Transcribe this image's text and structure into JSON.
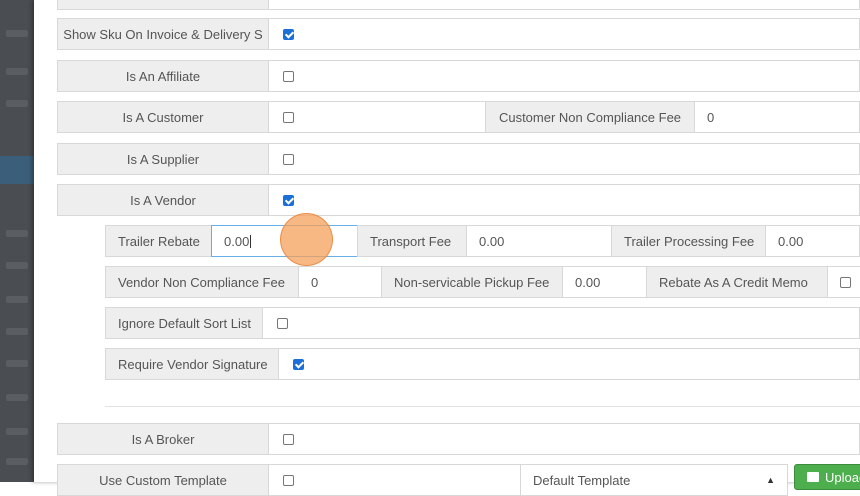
{
  "form": {
    "show_sku": {
      "label": "Show Sku On Invoice & Delivery S",
      "checked": true
    },
    "is_affiliate": {
      "label": "Is An Affiliate",
      "checked": false
    },
    "is_customer": {
      "label": "Is A Customer",
      "checked": false
    },
    "customer_fee": {
      "label": "Customer Non Compliance Fee",
      "value": "0"
    },
    "is_supplier": {
      "label": "Is A Supplier",
      "checked": false
    },
    "is_vendor": {
      "label": "Is A Vendor",
      "checked": true
    },
    "vendor": {
      "trailer_rebate": {
        "label": "Trailer Rebate",
        "value": "0.00"
      },
      "transport_fee": {
        "label": "Transport Fee",
        "value": "0.00"
      },
      "trailer_processing_fee": {
        "label": "Trailer Processing Fee",
        "value": "0.00"
      },
      "vendor_fee": {
        "label": "Vendor Non Compliance Fee",
        "value": "0"
      },
      "pickup_fee": {
        "label": "Non-servicable Pickup Fee",
        "value": "0.00"
      },
      "rebate_credit_memo": {
        "label": "Rebate As A Credit Memo",
        "checked": false
      },
      "ignore_sort": {
        "label": "Ignore Default Sort List",
        "checked": false
      },
      "require_signature": {
        "label": "Require Vendor Signature",
        "checked": true
      }
    },
    "is_broker": {
      "label": "Is A Broker",
      "checked": false
    },
    "custom_template": {
      "label": "Use Custom Template",
      "checked": false,
      "template_value": "Default Template",
      "upload_label": "Upload"
    }
  },
  "colors": {
    "checkbox_on": "#1b6fd8",
    "label_bg": "#eeeeee",
    "upload_green": "#4cae4c"
  },
  "icons": {
    "upload": "image-icon",
    "select": "caret-icon"
  }
}
